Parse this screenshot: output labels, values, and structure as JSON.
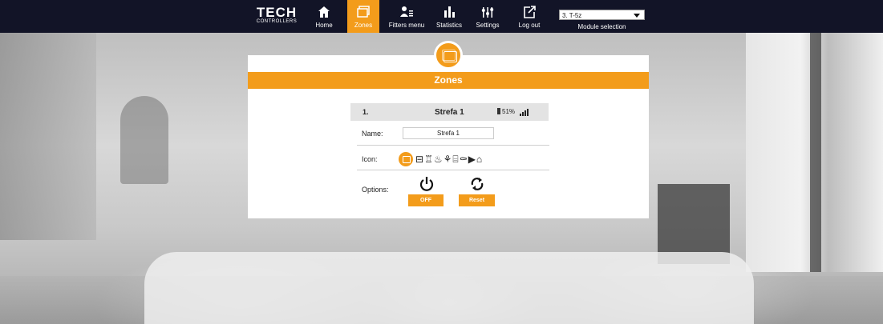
{
  "nav": {
    "logo_big": "TECH",
    "logo_small": "CONTROLLERS",
    "items": [
      {
        "label": "Home",
        "icon": "home-icon"
      },
      {
        "label": "Zones",
        "icon": "zones-icon",
        "active": true
      },
      {
        "label": "Fitters menu",
        "icon": "fitters-icon"
      },
      {
        "label": "Statistics",
        "icon": "statistics-icon"
      },
      {
        "label": "Settings",
        "icon": "settings-icon"
      },
      {
        "label": "Log out",
        "icon": "logout-icon"
      }
    ],
    "module_value": "3. T-5z",
    "module_label": "Module selection"
  },
  "panel": {
    "title": "Zones",
    "zone": {
      "number": "1.",
      "name": "Strefa 1",
      "battery": "51%"
    },
    "name_label": "Name:",
    "name_value": "Strefa 1",
    "icon_label": "Icon:",
    "icon_glyphs": [
      "⊟",
      "♖",
      "♨",
      "⚘",
      "⌸",
      "⚰",
      "▶",
      "⌂"
    ],
    "options_label": "Options:",
    "off_button": "OFF",
    "reset_button": "Reset"
  },
  "colors": {
    "accent": "#f39c1b",
    "topbar": "#121427"
  }
}
